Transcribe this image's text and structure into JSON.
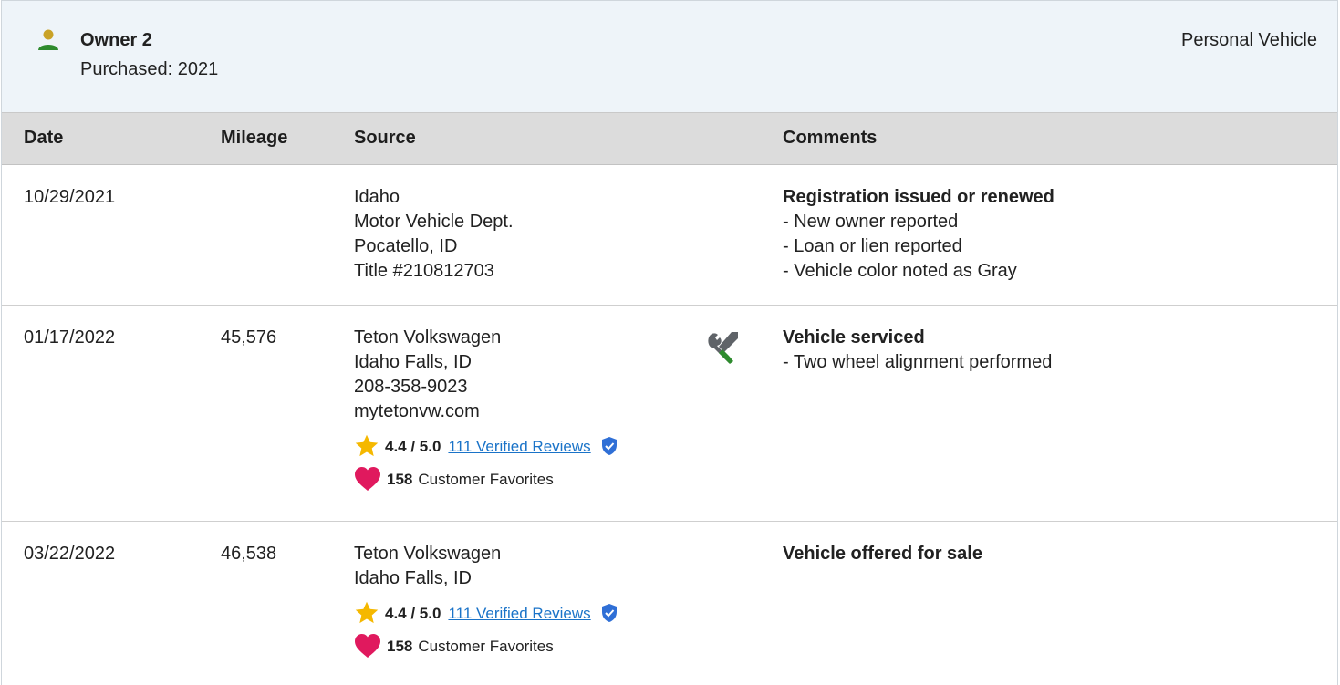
{
  "owner": {
    "title": "Owner 2",
    "purchased": "Purchased: 2021",
    "vehicle_type": "Personal Vehicle",
    "icon": "person-icon"
  },
  "table": {
    "headers": [
      "Date",
      "Mileage",
      "Source",
      "Comments"
    ],
    "rows": [
      {
        "date": "10/29/2021",
        "mileage": "",
        "source": [
          "Idaho",
          "Motor Vehicle Dept.",
          "Pocatello, ID",
          "Title #210812703"
        ],
        "comment_title": "Registration issued or renewed",
        "comment_items": [
          "- New owner reported",
          "- Loan or lien reported",
          "- Vehicle color noted as Gray"
        ]
      },
      {
        "date": "01/17/2022",
        "mileage": "45,576",
        "source": [
          "Teton Volkswagen",
          "Idaho Falls, ID",
          "208-358-9023",
          "mytetonvw.com"
        ],
        "icon": "service-tools-icon",
        "rating": "4.4 / 5.0",
        "reviews_link": "111 Verified Reviews",
        "favorites_count": "158",
        "favorites_label": "Customer Favorites",
        "comment_title": "Vehicle serviced",
        "comment_items": [
          "- Two wheel alignment performed"
        ]
      },
      {
        "date": "03/22/2022",
        "mileage": "46,538",
        "source": [
          "Teton Volkswagen",
          "Idaho Falls, ID"
        ],
        "rating": "4.4 / 5.0",
        "reviews_link": "111 Verified Reviews",
        "favorites_count": "158",
        "favorites_label": "Customer Favorites",
        "comment_title": "Vehicle offered for sale",
        "comment_items": []
      }
    ]
  },
  "colors": {
    "header_bg": "#eef4f9",
    "table_head_bg": "#dcdcdc",
    "link": "#1a73c8",
    "star": "#f5b800",
    "heart": "#e0195e",
    "shield": "#2f6fd6",
    "person_green": "#2e8b2e",
    "person_gold": "#c9a227"
  }
}
